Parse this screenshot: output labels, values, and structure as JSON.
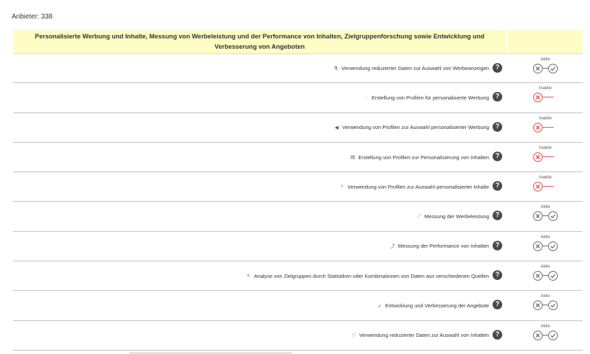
{
  "vendors": {
    "label": "Anbieter: 338"
  },
  "header": {
    "title": "Personalisierte Werbung und Inhalte, Messung von Werbeleistung und der Performance von Inhalten, Zielgruppenforschung sowie Entwicklung und Verbesserung von Angeboten"
  },
  "colors": {
    "header_bg": "#fdfdc4",
    "active": "#666666",
    "inactive": "#d9534f"
  },
  "rows": [
    {
      "icon": "reduced-data-icon",
      "glyph": "⚗",
      "label": "Verwendung reduzierter Daten zur Auswahl von Werbeanzeigen",
      "status": "Aktiv",
      "on": true
    },
    {
      "icon": "profile-ad-icon",
      "glyph": "◌",
      "label": "Erstellung von Profilen für personalisierte Werbung",
      "status": "Inaktiv",
      "on": false
    },
    {
      "icon": "megaphone-icon",
      "glyph": "◀",
      "label": "Verwendung von Profilen zur Auswahl personalisierter Werbung",
      "status": "Inaktiv",
      "on": false
    },
    {
      "icon": "content-profile-icon",
      "glyph": "▤",
      "label": "Erstellung von Profilen zur Personalisierung von Inhalten",
      "status": "Inaktiv",
      "on": false
    },
    {
      "icon": "content-search-icon",
      "glyph": "⌕",
      "label": "Verwendung von Profilen zur Auswahl personalisierter Inhalte",
      "status": "Inaktiv",
      "on": false
    },
    {
      "icon": "ad-performance-icon",
      "glyph": "⟋",
      "label": "Messung der Werbeleistung",
      "status": "Aktiv",
      "on": true
    },
    {
      "icon": "content-performance-icon",
      "glyph": "⤴",
      "label": "Messung der Performance von Inhalten",
      "status": "Aktiv",
      "on": true
    },
    {
      "icon": "share-icon",
      "glyph": "<",
      "label": "Analyse von Zielgruppen durch Statistiken oder Kombinationen von Daten aus verschiedenen Quellen",
      "status": "Aktiv",
      "on": true
    },
    {
      "icon": "rocket-icon",
      "glyph": "➶",
      "label": "Entwicklung und Verbesserung der Angebote",
      "status": "Aktiv",
      "on": true
    },
    {
      "icon": "heart-icon",
      "glyph": "♡",
      "label": "Verwendung reduzierter Daten zur Auswahl von Inhalten",
      "status": "Aktiv",
      "on": true
    }
  ]
}
